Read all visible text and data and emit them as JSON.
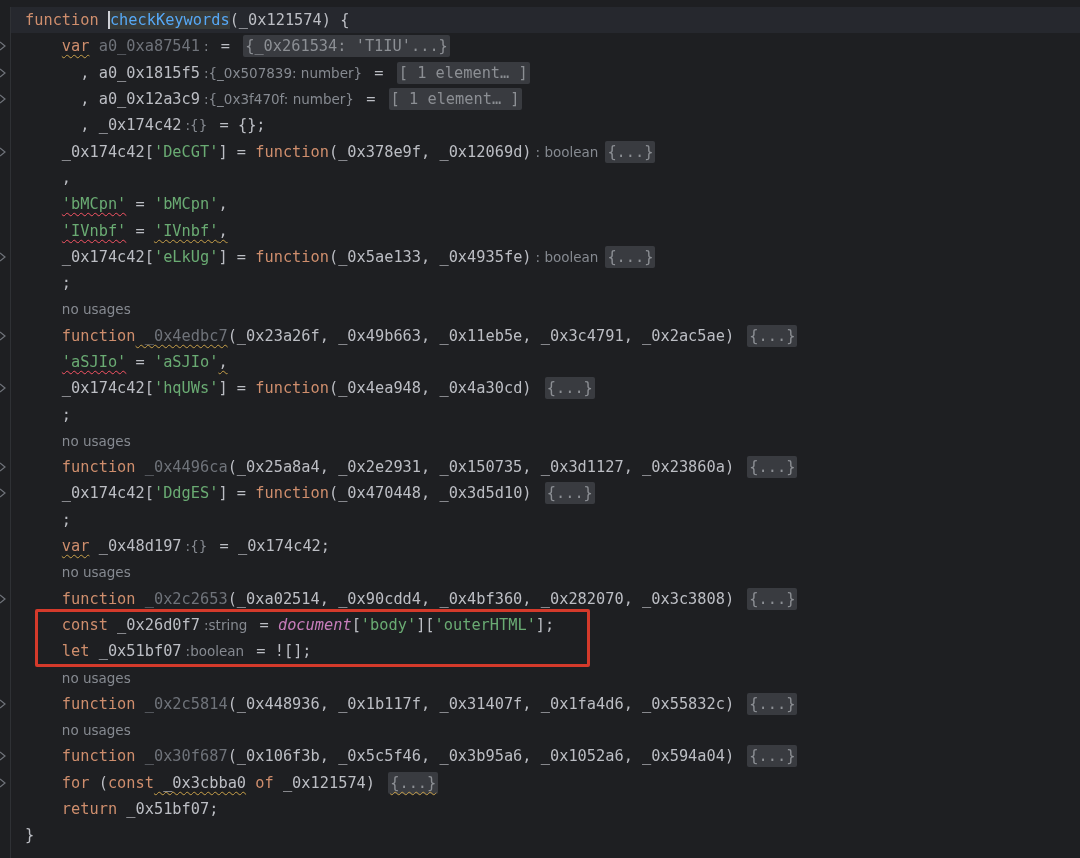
{
  "lines": [
    {
      "kind": "code",
      "current": true,
      "foldable": false,
      "tokens": [
        {
          "kind": "kw",
          "text": "function "
        },
        {
          "kind": "decl",
          "text": "checkKeywords",
          "highlight": true,
          "caret": true
        },
        {
          "kind": "plain",
          "text": "(_0x121574) {"
        }
      ],
      "children": [
        {
          "kind": "code",
          "foldable": true,
          "tokens": [
            {
              "kind": "kw",
              "text": "var",
              "warning": true
            },
            {
              "kind": "unused",
              "text": " a0_0xa87541"
            },
            {
              "kind": "hint",
              "text": ":"
            },
            {
              "kind": "plain",
              "text": " = "
            },
            {
              "kind": "fold",
              "text": "{_0x261534: 'T1IU'...}"
            }
          ]
        },
        {
          "kind": "continuation",
          "foldable": true,
          "tokens": [
            {
              "kind": "plain",
              "text": ", a0_0x1815f5"
            },
            {
              "kind": "hint",
              "text": ":{_0x507839: number}"
            },
            {
              "kind": "plain",
              "text": " = "
            },
            {
              "kind": "fold",
              "text": "[ 1 element… ]"
            }
          ]
        },
        {
          "kind": "continuation",
          "foldable": true,
          "tokens": [
            {
              "kind": "plain",
              "text": ", a0_0x12a3c9"
            },
            {
              "kind": "hint",
              "text": ":{_0x3f470f: number}"
            },
            {
              "kind": "plain",
              "text": " = "
            },
            {
              "kind": "fold",
              "text": "[ 1 element… ]"
            }
          ]
        },
        {
          "kind": "continuation",
          "foldable": false,
          "tokens": [
            {
              "kind": "plain",
              "text": ", _0x174c42"
            },
            {
              "kind": "hint",
              "text": ":{}"
            },
            {
              "kind": "plain",
              "text": " = {};"
            }
          ]
        },
        {
          "kind": "code",
          "foldable": true,
          "tokens": [
            {
              "kind": "plain",
              "text": "_0x174c42["
            },
            {
              "kind": "str",
              "text": "'DeCGT'"
            },
            {
              "kind": "plain",
              "text": "] = "
            },
            {
              "kind": "kw",
              "text": "function"
            },
            {
              "kind": "plain",
              "text": "(_0x378e9f, _0x12069d)"
            },
            {
              "kind": "hint",
              "text": ": boolean"
            },
            {
              "kind": "fold",
              "text": "{...}"
            }
          ]
        },
        {
          "kind": "code",
          "foldable": false,
          "tokens": [
            {
              "kind": "plain",
              "text": ","
            }
          ]
        },
        {
          "kind": "code",
          "foldable": false,
          "tokens": [
            {
              "kind": "str",
              "text": "'bMCpn'",
              "error": true
            },
            {
              "kind": "plain",
              "text": " = "
            },
            {
              "kind": "str",
              "text": "'bMCpn'"
            },
            {
              "kind": "plain",
              "text": ","
            }
          ]
        },
        {
          "kind": "code",
          "foldable": false,
          "tokens": [
            {
              "kind": "str",
              "text": "'IVnbf'",
              "error": true
            },
            {
              "kind": "plain",
              "text": " = "
            },
            {
              "kind": "str",
              "text": "'IVnbf'",
              "warning": true
            },
            {
              "kind": "plain",
              "text": ",",
              "warning": true
            }
          ]
        },
        {
          "kind": "code",
          "foldable": true,
          "tokens": [
            {
              "kind": "plain",
              "text": "_0x174c42["
            },
            {
              "kind": "str",
              "text": "'eLkUg'"
            },
            {
              "kind": "plain",
              "text": "] = "
            },
            {
              "kind": "kw",
              "text": "function"
            },
            {
              "kind": "plain",
              "text": "(_0x5ae133, _0x4935fe)"
            },
            {
              "kind": "hint",
              "text": ": boolean"
            },
            {
              "kind": "fold",
              "text": "{...}"
            }
          ]
        },
        {
          "kind": "code",
          "foldable": false,
          "tokens": [
            {
              "kind": "plain",
              "text": ";"
            }
          ]
        },
        {
          "kind": "usage",
          "foldable": false,
          "tokens": [
            {
              "kind": "hint",
              "text": "no usages"
            }
          ]
        },
        {
          "kind": "code",
          "foldable": true,
          "tokens": [
            {
              "kind": "kw",
              "text": "function"
            },
            {
              "kind": "unused",
              "text": " _0x4edbc7",
              "warning": true
            },
            {
              "kind": "plain",
              "text": "(_0x23a26f, _0x49b663, _0x11eb5e, _0x3c4791, _0x2ac5ae) "
            },
            {
              "kind": "fold",
              "text": "{...}"
            }
          ]
        },
        {
          "kind": "code",
          "foldable": false,
          "tokens": [
            {
              "kind": "str",
              "text": "'aSJIo'",
              "error": true
            },
            {
              "kind": "plain",
              "text": " = "
            },
            {
              "kind": "str",
              "text": "'aSJIo'"
            },
            {
              "kind": "plain",
              "text": ",",
              "warning": true
            }
          ]
        },
        {
          "kind": "code",
          "foldable": true,
          "tokens": [
            {
              "kind": "plain",
              "text": "_0x174c42["
            },
            {
              "kind": "str",
              "text": "'hqUWs'"
            },
            {
              "kind": "plain",
              "text": "] = "
            },
            {
              "kind": "kw",
              "text": "function"
            },
            {
              "kind": "plain",
              "text": "(_0x4ea948, _0x4a30cd) "
            },
            {
              "kind": "fold",
              "text": "{...}"
            }
          ]
        },
        {
          "kind": "code",
          "foldable": false,
          "tokens": [
            {
              "kind": "plain",
              "text": ";"
            }
          ]
        },
        {
          "kind": "usage",
          "foldable": false,
          "tokens": [
            {
              "kind": "hint",
              "text": "no usages"
            }
          ]
        },
        {
          "kind": "code",
          "foldable": true,
          "tokens": [
            {
              "kind": "kw",
              "text": "function"
            },
            {
              "kind": "unused",
              "text": " _0x4496ca"
            },
            {
              "kind": "plain",
              "text": "(_0x25a8a4, _0x2e2931, _0x150735, _0x3d1127, _0x23860a) "
            },
            {
              "kind": "fold",
              "text": "{...}"
            }
          ]
        },
        {
          "kind": "code",
          "foldable": true,
          "tokens": [
            {
              "kind": "plain",
              "text": "_0x174c42["
            },
            {
              "kind": "str",
              "text": "'DdgES'"
            },
            {
              "kind": "plain",
              "text": "] = "
            },
            {
              "kind": "kw",
              "text": "function"
            },
            {
              "kind": "plain",
              "text": "(_0x470448, _0x3d5d10) "
            },
            {
              "kind": "fold",
              "text": "{...}"
            }
          ]
        },
        {
          "kind": "code",
          "foldable": false,
          "tokens": [
            {
              "kind": "plain",
              "text": ";"
            }
          ]
        },
        {
          "kind": "code",
          "foldable": false,
          "tokens": [
            {
              "kind": "kw",
              "text": "var",
              "warning": true
            },
            {
              "kind": "plain",
              "text": " _0x48d197"
            },
            {
              "kind": "hint",
              "text": ":{}"
            },
            {
              "kind": "plain",
              "text": " = _0x174c42;"
            }
          ]
        },
        {
          "kind": "usage",
          "foldable": false,
          "tokens": [
            {
              "kind": "hint",
              "text": "no usages"
            }
          ]
        },
        {
          "kind": "code",
          "foldable": true,
          "tokens": [
            {
              "kind": "kw",
              "text": "function"
            },
            {
              "kind": "unused",
              "text": " _0x2c2653"
            },
            {
              "kind": "plain",
              "text": "(_0xa02514, _0x90cdd4, _0x4bf360, _0x282070, _0x3c3808) "
            },
            {
              "kind": "fold",
              "text": "{...}"
            }
          ]
        },
        {
          "kind": "code",
          "foldable": false,
          "boxed": true,
          "tokens": [
            {
              "kind": "kw",
              "text": "const"
            },
            {
              "kind": "plain",
              "text": " _0x26d0f7"
            },
            {
              "kind": "hint",
              "text": ":string"
            },
            {
              "kind": "plain",
              "text": " = "
            },
            {
              "kind": "doc",
              "text": "document"
            },
            {
              "kind": "plain",
              "text": "["
            },
            {
              "kind": "str",
              "text": "'body'"
            },
            {
              "kind": "plain",
              "text": "]["
            },
            {
              "kind": "str",
              "text": "'outerHTML'"
            },
            {
              "kind": "plain",
              "text": "];"
            }
          ]
        },
        {
          "kind": "code",
          "foldable": false,
          "boxed": true,
          "tokens": [
            {
              "kind": "kw",
              "text": "let"
            },
            {
              "kind": "plain",
              "text": " _0x51bf07"
            },
            {
              "kind": "hint",
              "text": ":boolean"
            },
            {
              "kind": "plain",
              "text": " = ![];"
            }
          ]
        },
        {
          "kind": "usage",
          "foldable": false,
          "tokens": [
            {
              "kind": "hint",
              "text": "no usages"
            }
          ]
        },
        {
          "kind": "code",
          "foldable": true,
          "tokens": [
            {
              "kind": "kw",
              "text": "function"
            },
            {
              "kind": "unused",
              "text": " _0x2c5814"
            },
            {
              "kind": "plain",
              "text": "(_0x448936, _0x1b117f, _0x31407f, _0x1fa4d6, _0x55832c) "
            },
            {
              "kind": "fold",
              "text": "{...}"
            }
          ]
        },
        {
          "kind": "usage",
          "foldable": false,
          "tokens": [
            {
              "kind": "hint",
              "text": "no usages"
            }
          ]
        },
        {
          "kind": "code",
          "foldable": true,
          "tokens": [
            {
              "kind": "kw",
              "text": "function"
            },
            {
              "kind": "unused",
              "text": " _0x30f687"
            },
            {
              "kind": "plain",
              "text": "(_0x106f3b, _0x5c5f46, _0x3b95a6, _0x1052a6, _0x594a04) "
            },
            {
              "kind": "fold",
              "text": "{...}"
            }
          ]
        },
        {
          "kind": "code",
          "foldable": true,
          "tokens": [
            {
              "kind": "kw",
              "text": "for"
            },
            {
              "kind": "plain",
              "text": " ("
            },
            {
              "kind": "kw",
              "text": "const"
            },
            {
              "kind": "plain",
              "text": " _0x3cbba0",
              "warning": true
            },
            {
              "kind": "kw",
              "text": " of"
            },
            {
              "kind": "plain",
              "text": " _0x121574) "
            },
            {
              "kind": "fold",
              "text": "{...}",
              "warning": true
            }
          ]
        },
        {
          "kind": "code",
          "foldable": false,
          "tokens": [
            {
              "kind": "kw",
              "text": "return"
            },
            {
              "kind": "plain",
              "text": " _0x51bf07;"
            }
          ]
        }
      ]
    },
    {
      "kind": "code",
      "foldable": false,
      "tokens": [
        {
          "kind": "plain",
          "text": "}"
        }
      ]
    }
  ]
}
